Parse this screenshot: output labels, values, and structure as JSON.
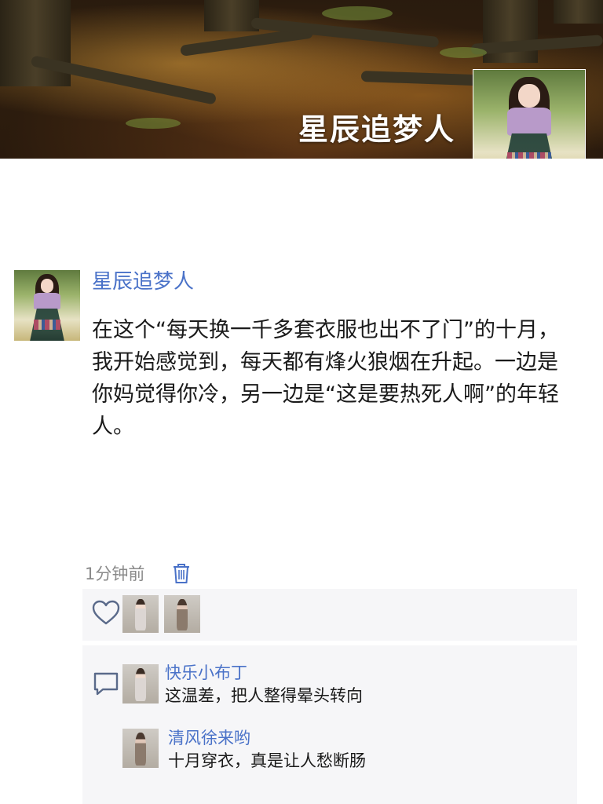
{
  "cover": {
    "title": "星辰追梦人"
  },
  "post": {
    "author": "星辰追梦人",
    "text": "在这个“每天换一千多套衣服也出不了门”的十月，我开始感觉到，每天都有烽火狼烟在升起。一边是你妈觉得你冷，另一边是“这是要热死人啊”的年轻人。",
    "time": "1分钟前"
  },
  "likes": {
    "icon": "heart-icon"
  },
  "comments": [
    {
      "author": "快乐小布丁",
      "text": "这温差，把人整得晕头转向"
    },
    {
      "author": "清风徐来哟",
      "text": "十月穿衣，真是让人愁断肠"
    }
  ],
  "colors": {
    "link": "#4a72c8",
    "panel": "#f6f6f8",
    "time": "#8a8a8a"
  }
}
